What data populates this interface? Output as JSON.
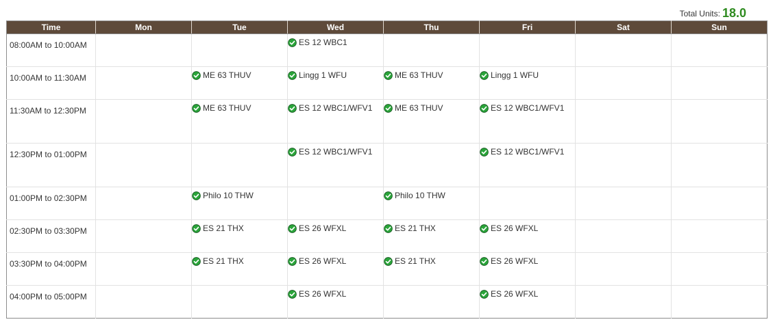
{
  "total_units": {
    "label": "Total Units:",
    "value": "18.0"
  },
  "colors": {
    "header_bg": "#5e4a3a",
    "units_green": "#2e8b1f",
    "check_green": "#2aa53a"
  },
  "icons": {
    "course_status": "check-circle-icon"
  },
  "columns": [
    "Time",
    "Mon",
    "Tue",
    "Wed",
    "Thu",
    "Fri",
    "Sat",
    "Sun"
  ],
  "rows": [
    {
      "time": "08:00AM to 10:00AM",
      "cells": [
        "",
        "",
        "ES 12 WBC1",
        "",
        "",
        "",
        ""
      ]
    },
    {
      "time": "10:00AM to 11:30AM",
      "cells": [
        "",
        "ME 63 THUV",
        "Lingg 1 WFU",
        "ME 63 THUV",
        "Lingg 1 WFU",
        "",
        ""
      ]
    },
    {
      "time": "11:30AM to 12:30PM",
      "cells": [
        "",
        "ME 63 THUV",
        "ES 12 WBC1/WFV1",
        "ME 63 THUV",
        "ES 12 WBC1/WFV1",
        "",
        ""
      ]
    },
    {
      "time": "12:30PM to 01:00PM",
      "cells": [
        "",
        "",
        "ES 12 WBC1/WFV1",
        "",
        "ES 12 WBC1/WFV1",
        "",
        ""
      ]
    },
    {
      "time": "01:00PM to 02:30PM",
      "cells": [
        "",
        "Philo 10 THW",
        "",
        "Philo 10 THW",
        "",
        "",
        ""
      ]
    },
    {
      "time": "02:30PM to 03:30PM",
      "cells": [
        "",
        "ES 21 THX",
        "ES 26 WFXL",
        "ES 21 THX",
        "ES 26 WFXL",
        "",
        ""
      ]
    },
    {
      "time": "03:30PM to 04:00PM",
      "cells": [
        "",
        "ES 21 THX",
        "ES 26 WFXL",
        "ES 21 THX",
        "ES 26 WFXL",
        "",
        ""
      ]
    },
    {
      "time": "04:00PM to 05:00PM",
      "cells": [
        "",
        "",
        "ES 26 WFXL",
        "",
        "ES 26 WFXL",
        "",
        ""
      ]
    }
  ]
}
